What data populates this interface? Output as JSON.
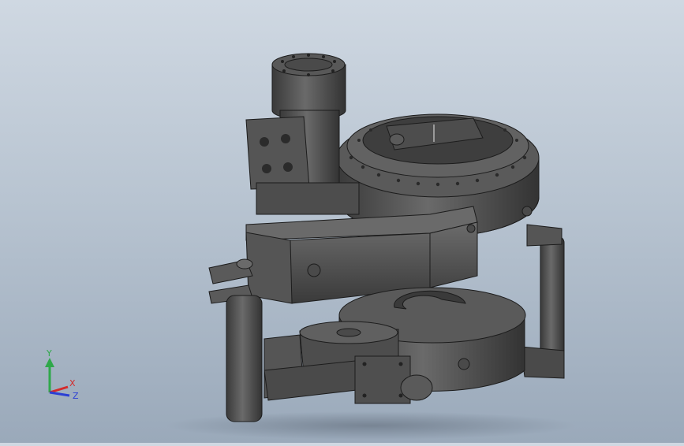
{
  "viewport": {
    "background_top": "#cfd8e2",
    "background_bottom": "#9aa9ba",
    "model_color": "#4a4a4a",
    "edge_color": "#1c1c1c"
  },
  "triad": {
    "x_label": "X",
    "y_label": "Y",
    "z_label": "Z",
    "x_color": "#d42b2b",
    "y_color": "#2fa84a",
    "z_color": "#2b3fd4"
  }
}
